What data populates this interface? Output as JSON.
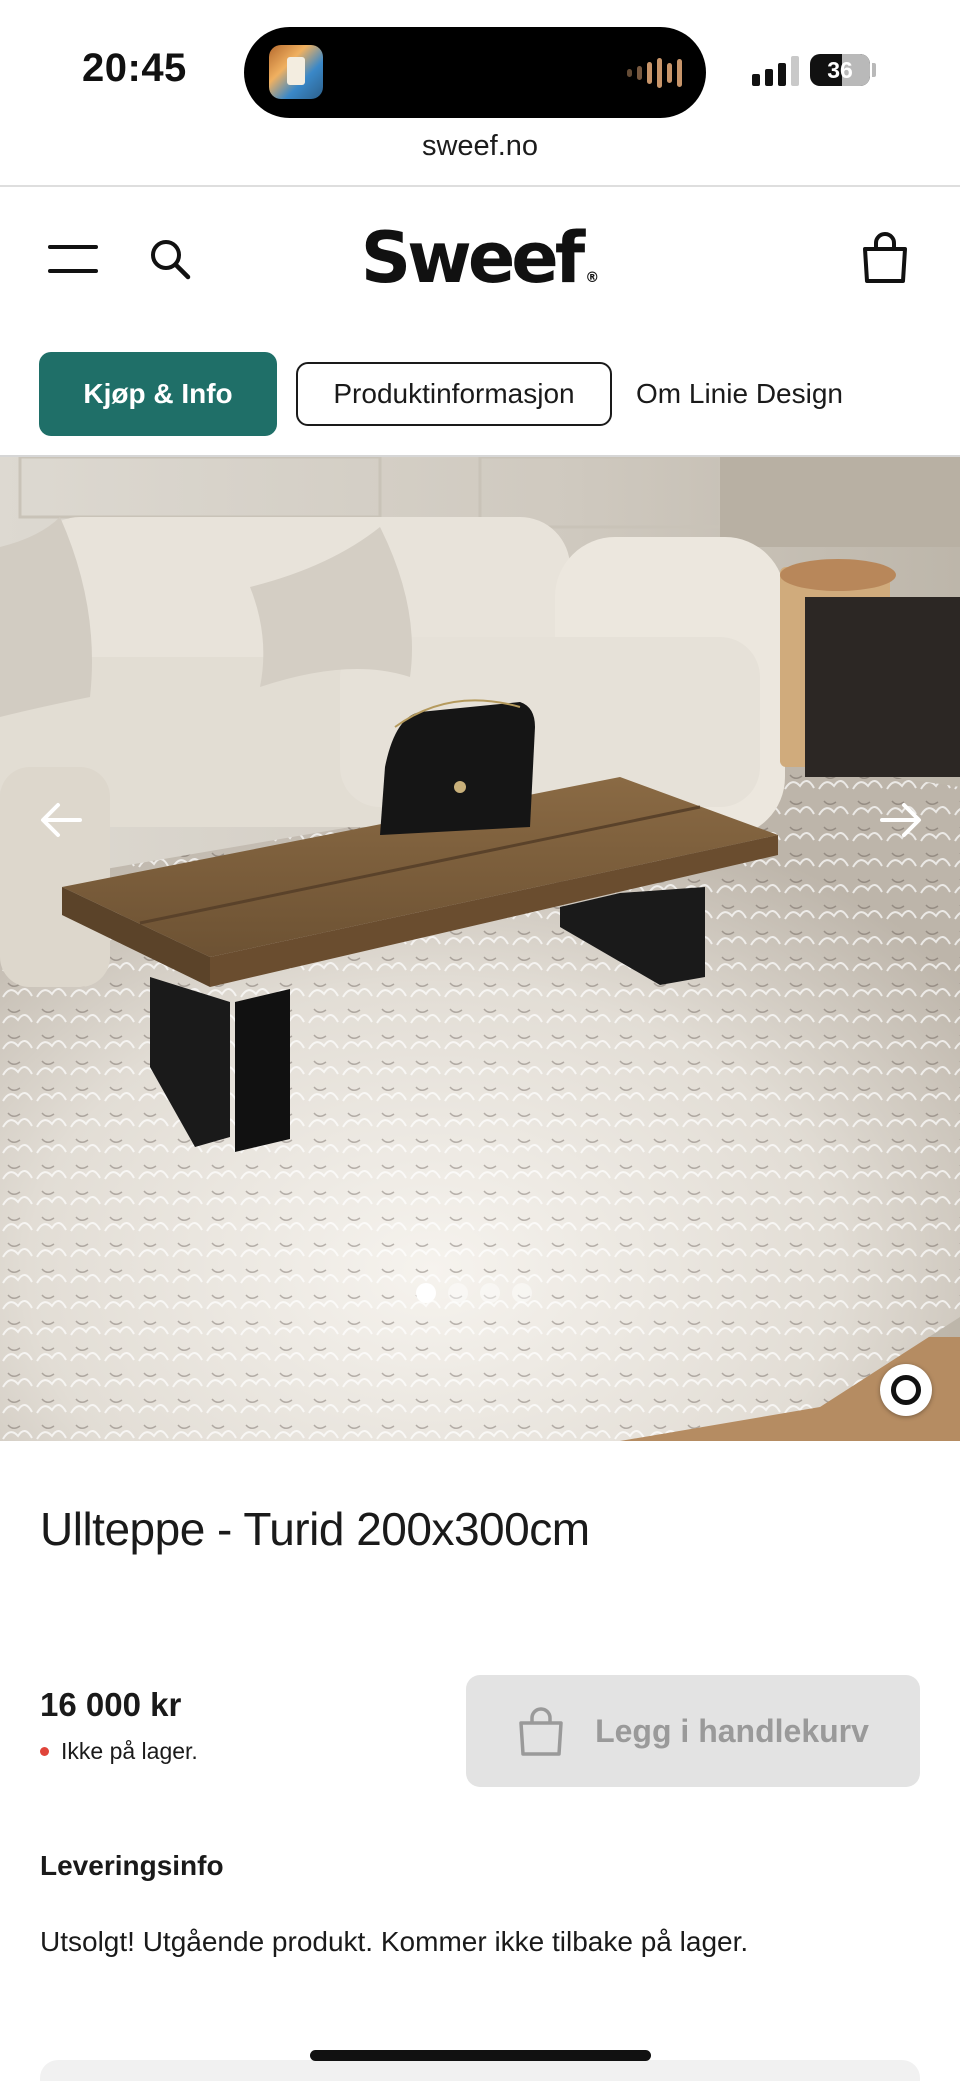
{
  "status_bar": {
    "time": "20:45",
    "battery": "36"
  },
  "browser": {
    "url": "sweef.no"
  },
  "header": {
    "logo": "Sweef",
    "logo_mark": "®"
  },
  "tabs": [
    {
      "label": "Kjøp & Info",
      "state": "active"
    },
    {
      "label": "Produktinformasjon",
      "state": "outlined"
    },
    {
      "label": "Om Linie Design",
      "state": "plain"
    }
  ],
  "gallery": {
    "image_count": 4,
    "current_index": 1
  },
  "product": {
    "title": "Ullteppe - Turid 200x300cm",
    "price": "16 000 kr",
    "stock_status": "Ikke på lager.",
    "add_to_cart_label": "Legg i handlekurv",
    "delivery_heading": "Leveringsinfo",
    "delivery_text": "Utsolgt! Utgående produkt. Kommer ikke tilbake på lager."
  },
  "colors": {
    "accent": "#1f6f68",
    "stock_out": "#e0443a",
    "disabled_button": "#e3e3e3"
  },
  "icons": [
    "menu-icon",
    "search-icon",
    "cart-icon",
    "arrow-left-icon",
    "arrow-right-icon",
    "ring-icon",
    "bag-icon"
  ]
}
